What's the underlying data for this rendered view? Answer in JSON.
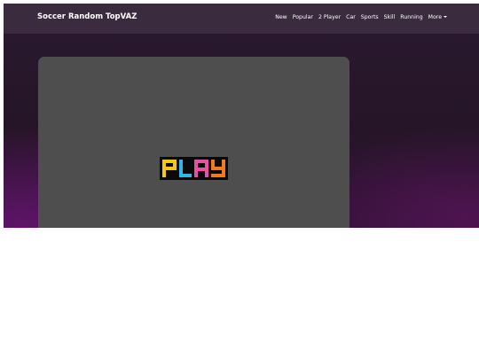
{
  "brand": {
    "title": "Soccer Random TopVAZ"
  },
  "nav": {
    "items": [
      {
        "label": "New"
      },
      {
        "label": "Popular"
      },
      {
        "label": "2 Player"
      },
      {
        "label": "Car"
      },
      {
        "label": "Sports"
      },
      {
        "label": "Skill"
      },
      {
        "label": "Running"
      },
      {
        "label": "More"
      }
    ]
  },
  "game": {
    "play_label": "PLAY",
    "letter_colors": [
      "#f5c518",
      "#2fb8e6",
      "#e94fa5",
      "#f07a1e"
    ],
    "icon": "play-logo-icon"
  },
  "colors": {
    "navbar": "#3a2b3f",
    "page_background": "#2a1a30",
    "game_frame": "#4e4e4e"
  }
}
